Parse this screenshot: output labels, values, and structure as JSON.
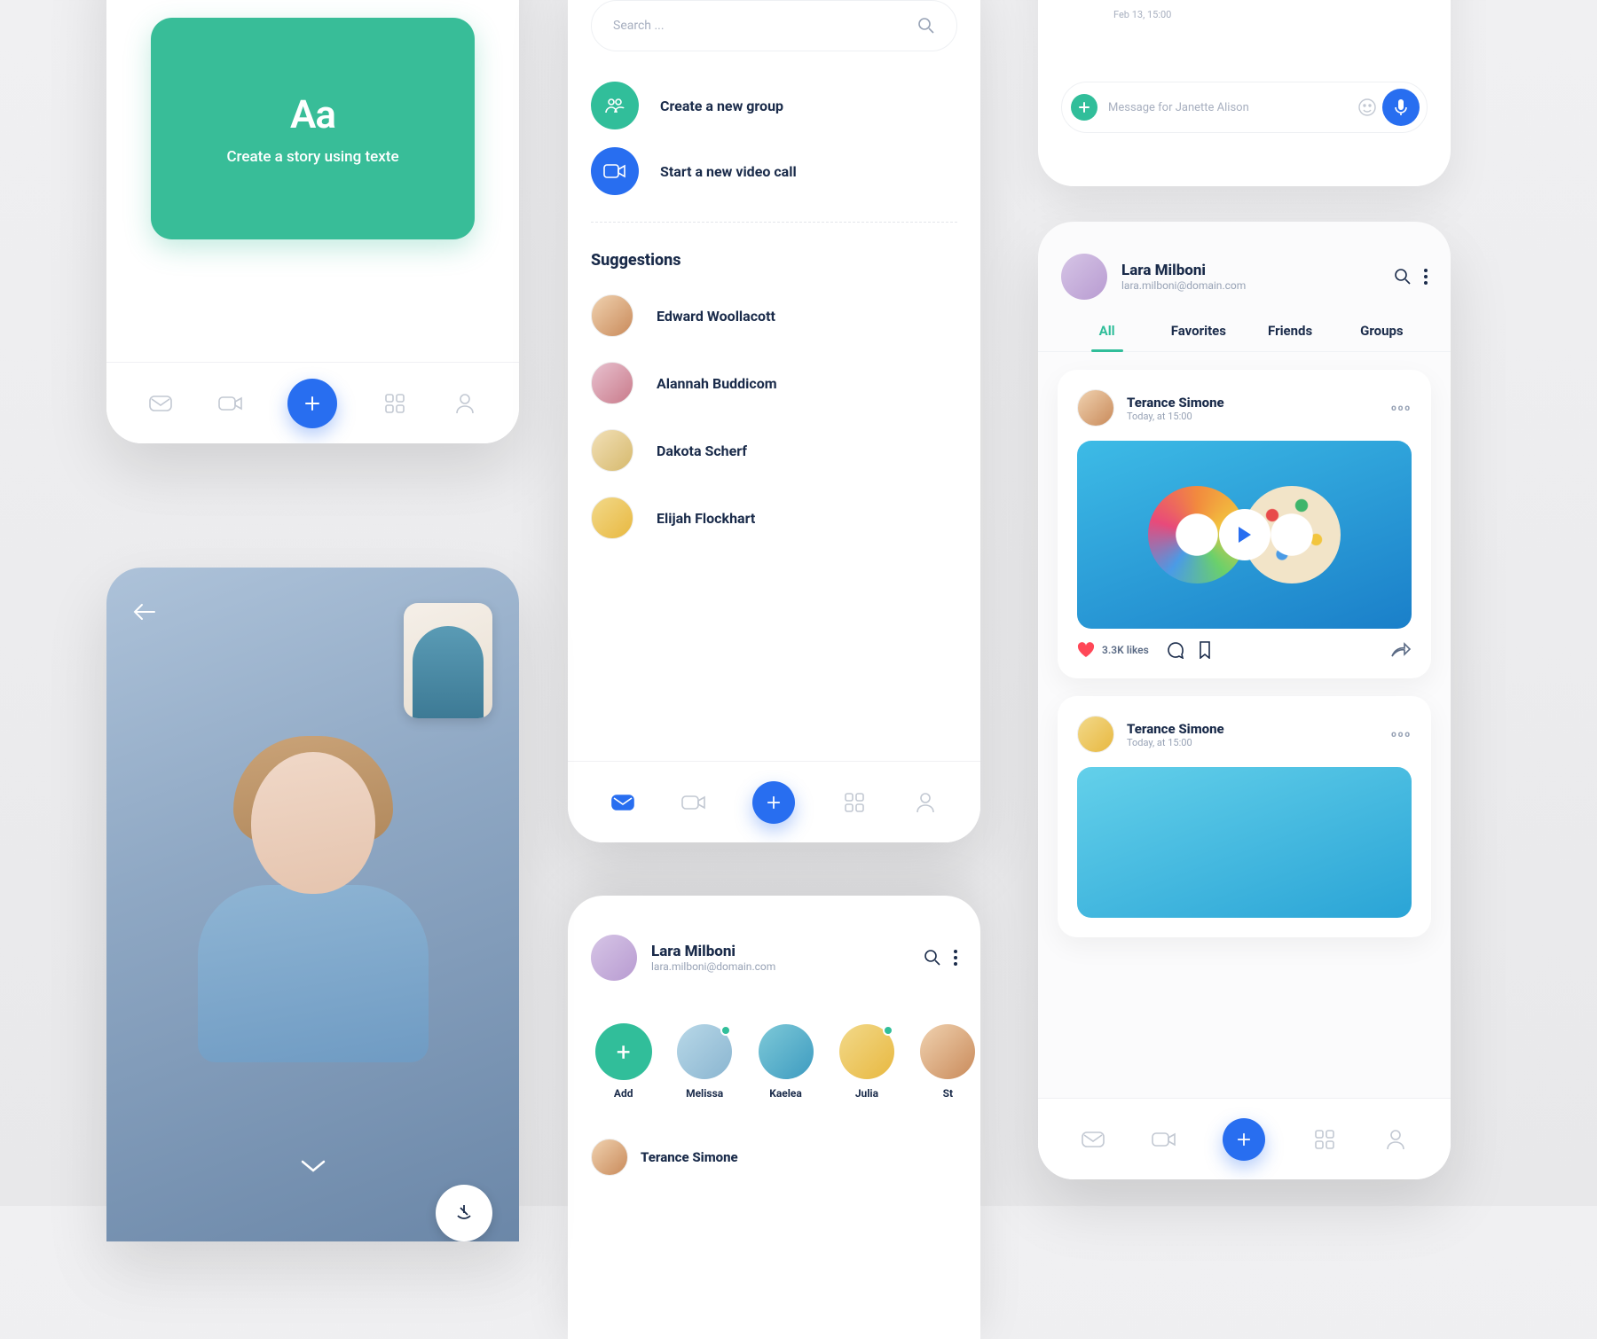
{
  "screen1": {
    "story_card_title": "Aa",
    "story_card_caption": "Create a story using texte"
  },
  "screen2": {
    "search_placeholder": "Search ...",
    "create_group_label": "Create a new group",
    "start_video_label": "Start a new video call",
    "suggestions_title": "Suggestions",
    "suggestions": [
      {
        "name": "Edward Woollacott"
      },
      {
        "name": "Alannah Buddicom"
      },
      {
        "name": "Dakota Scherf"
      },
      {
        "name": "Elijah Flockhart"
      }
    ]
  },
  "screen3": {
    "profile_name": "Lara Milboni",
    "profile_email": "lara.milboni@domain.com",
    "story_add_label": "Add",
    "stories": [
      {
        "name": "Melissa"
      },
      {
        "name": "Kaelea"
      },
      {
        "name": "Julia"
      },
      {
        "name": "St"
      }
    ],
    "feed_name": "Terance Simone"
  },
  "screen5": {
    "msg_timestamp": "Feb 13, 15:00",
    "input_placeholder": "Message for Janette Alison"
  },
  "screen6": {
    "profile_name": "Lara Milboni",
    "profile_email": "lara.milboni@domain.com",
    "tabs": {
      "all": "All",
      "favorites": "Favorites",
      "friends": "Friends",
      "groups": "Groups"
    },
    "posts": [
      {
        "author": "Terance Simone",
        "time": "Today, at 15:00",
        "likes": "3.3K likes"
      },
      {
        "author": "Terance Simone",
        "time": "Today, at 15:00"
      }
    ]
  }
}
